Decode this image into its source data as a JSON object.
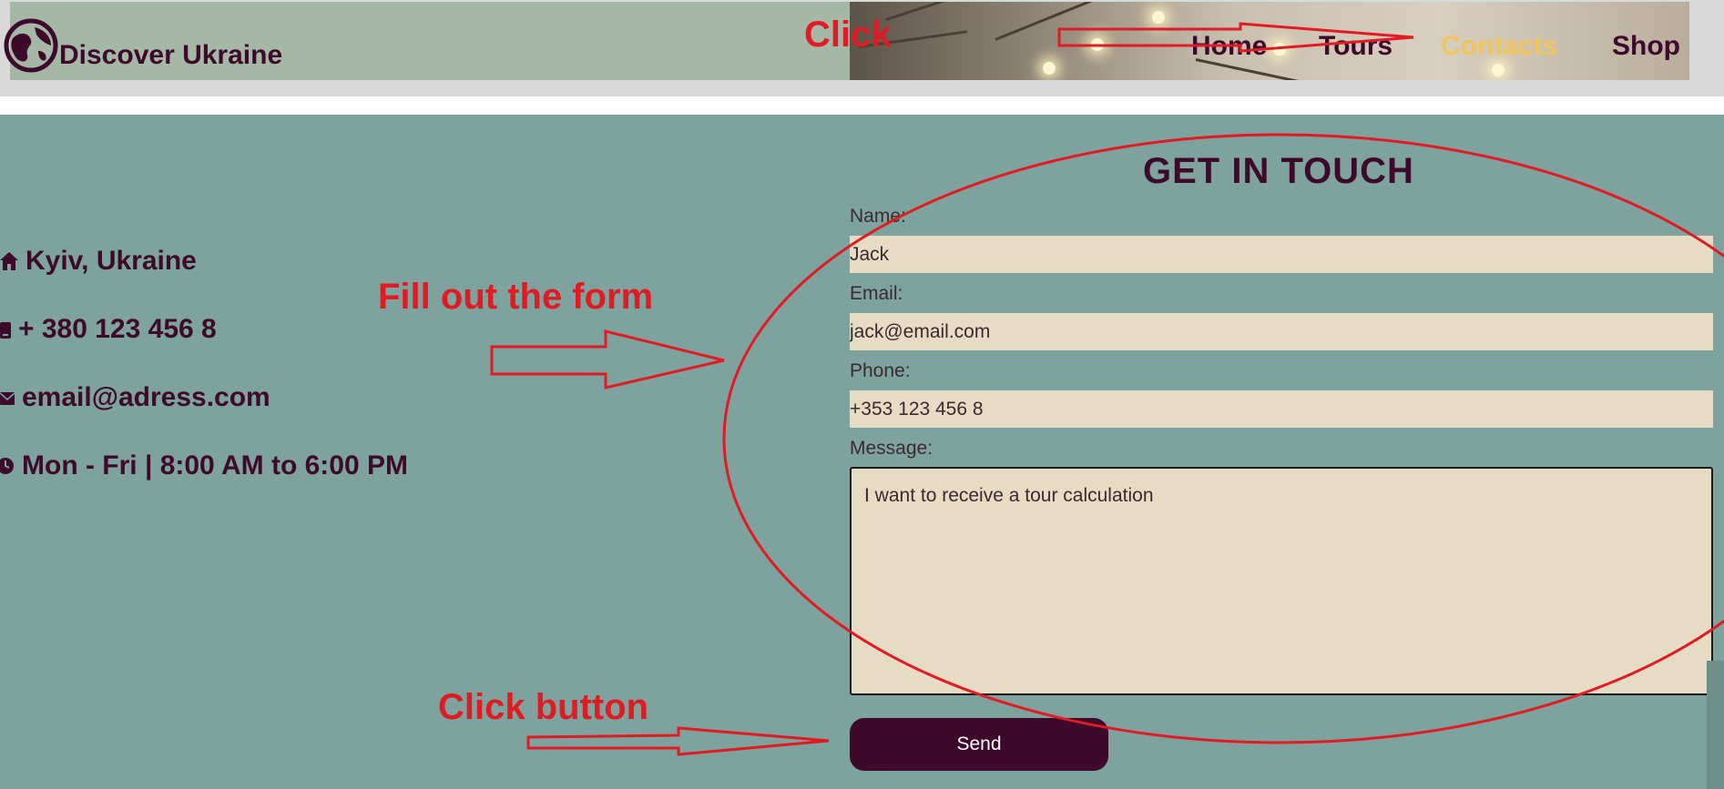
{
  "header": {
    "brand": "Discover Ukraine",
    "nav": [
      {
        "label": "Home",
        "active": false
      },
      {
        "label": "Tours",
        "active": false
      },
      {
        "label": "Contacts",
        "active": true
      },
      {
        "label": "Shop",
        "active": false
      }
    ]
  },
  "contact_info": [
    {
      "icon": "home-icon",
      "text": "Kyiv, Ukraine"
    },
    {
      "icon": "phone-icon",
      "text": "+ 380 123 456 8"
    },
    {
      "icon": "envelope-icon",
      "text": "email@adress.com"
    },
    {
      "icon": "clock-icon",
      "text": "Mon - Fri | 8:00 AM to 6:00 PM"
    }
  ],
  "form": {
    "title": "GET IN TOUCH",
    "name_label": "Name:",
    "name_value": "Jack",
    "email_label": "Email:",
    "email_value": "jack@email.com",
    "phone_label": "Phone:",
    "phone_value": "+353 123 456 8",
    "message_label": "Message:",
    "message_value": "I want to receive a tour calculation",
    "send_label": "Send"
  },
  "annotations": {
    "click": "Click",
    "fill_form": "Fill out the form",
    "click_button": "Click button"
  },
  "colors": {
    "brand": "#3d0a2c",
    "active_nav": "#f2c55c",
    "background": "#7ea39e",
    "field": "#e6dcc3",
    "annotation": "#e01b24"
  }
}
